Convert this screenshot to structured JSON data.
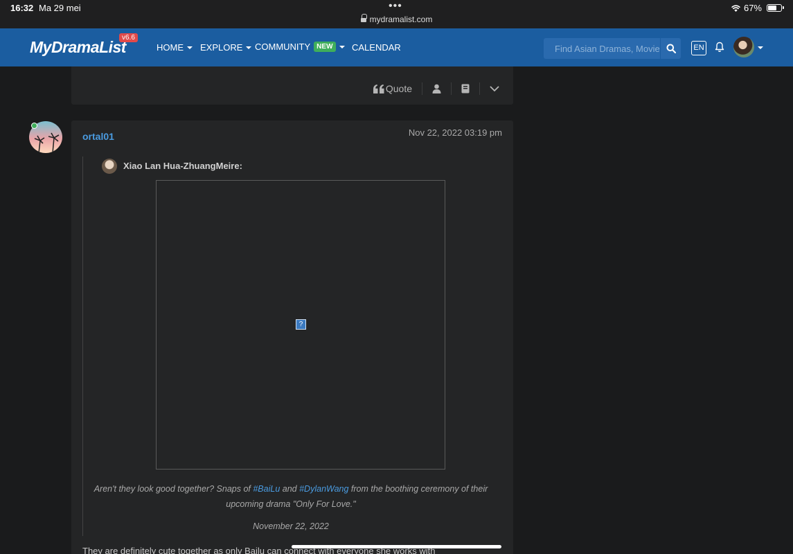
{
  "statusbar": {
    "time": "16:32",
    "date": "Ma 29 mei",
    "dots": "•••",
    "url": "mydramalist.com",
    "battery": "67%"
  },
  "nav": {
    "logo": "MyDramaList",
    "version": "v6.6",
    "items": [
      "HOME",
      "EXPLORE",
      "COMMUNITY",
      "CALENDAR"
    ],
    "new_badge": "NEW",
    "search_placeholder": "Find Asian Dramas, Movies",
    "lang": "EN"
  },
  "post_actions": {
    "quote_label": "Quote"
  },
  "post": {
    "username": "ortal01",
    "date": "Nov 22, 2022 03:19 pm",
    "quote": {
      "author": "Xiao Lan Hua-ZhuangMeire:",
      "caption_pre": "Aren't they look good together?  Snaps of ",
      "tag1": "#BaiLu",
      "caption_mid": " and ",
      "tag2": "#DylanWang",
      "caption_post": " from the boothing ceremony of their upcoming drama \"Only For Love.\"",
      "date": "November 22, 2022",
      "broken_image": "?"
    },
    "reply": "They are definitely cute together as only Bailu can connect with everyone she works with"
  },
  "colors": {
    "navbar": "#1b5da0",
    "panel": "#242526",
    "link": "#4a9be0",
    "new_badge": "#3fae5b",
    "version_badge": "#e24a4a"
  }
}
